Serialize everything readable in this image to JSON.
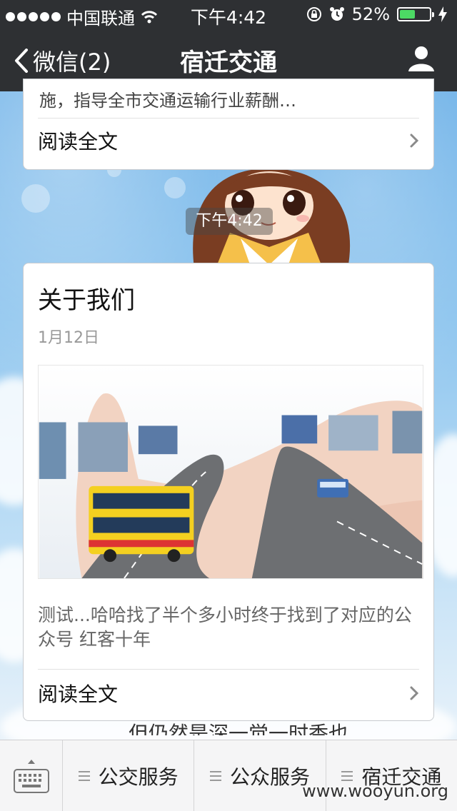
{
  "status_bar": {
    "carrier": "中国联通",
    "time": "下午4:42",
    "battery_percent": "52%",
    "battery_level": 0.52
  },
  "nav": {
    "back_label": "微信(2)",
    "title": "宿迁交通"
  },
  "messages": [
    {
      "truncated_text": "施，指导全市交通运输行业薪酬…",
      "read_all": "阅读全文"
    },
    {
      "timestamp": "下午4:42",
      "title": "关于我们",
      "date": "1月12日",
      "description": "测试...哈哈找了半个多小时终于找到了对应的公众号 红客十年",
      "read_all": "阅读全文"
    }
  ],
  "partial_text": "但仍然是深一觉一时香也。",
  "bottom_menu": {
    "items": [
      {
        "label": "公交服务"
      },
      {
        "label": "公众服务"
      },
      {
        "label": "宿迁交通"
      }
    ]
  },
  "watermark": "www.wooyun.org"
}
